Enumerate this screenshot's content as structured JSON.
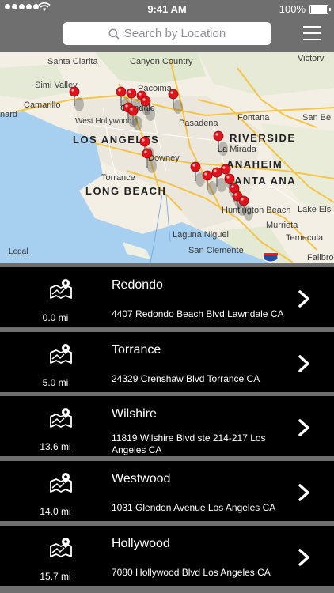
{
  "status_bar": {
    "time": "9:41 AM",
    "battery": "100%"
  },
  "header": {
    "search_placeholder": "Search by Location",
    "menu_icon": "hamburger-menu-icon"
  },
  "map": {
    "labels": {
      "santa_clarita": "Santa Clarita",
      "canyon_country": "Canyon Country",
      "victorville": "Victorv",
      "simi_valley": "Simi Valley",
      "pacoima": "Pacoima",
      "camarillo": "Camarillo",
      "glendale": "Glendale",
      "west_hollywood": "West Hollywood",
      "oxnard": "nard",
      "pasadena": "Pasadena",
      "fontana": "Fontana",
      "san_bernardino": "San Be",
      "los_angeles": "LOS ANGELES",
      "riverside": "RIVERSIDE",
      "downey": "Downey",
      "la_mirada": "La Mirada",
      "anaheim": "ANAHEIM",
      "torrance": "Torrance",
      "santa_ana": "SANTA ANA",
      "long_beach": "LONG BEACH",
      "huntington_beach": "Huntington Beach",
      "lake_elsinore": "Lake Els",
      "murrieta": "Murrieta",
      "temecula": "Temecula",
      "laguna_niguel": "Laguna Niguel",
      "san_clemente": "San Clemente",
      "fallbrook": "Fallbro",
      "legal": "Legal"
    }
  },
  "locations": [
    {
      "name": "Redondo",
      "address": "4407 Redondo Beach Blvd Lawndale CA",
      "distance": "0.0 mi"
    },
    {
      "name": "Torrance",
      "address": "24329 Crenshaw Blvd Torrance CA",
      "distance": "5.0 mi"
    },
    {
      "name": "Wilshire",
      "address": "11819 Wilshire Blvd ste 214-217 Los Angeles CA",
      "distance": "13.6 mi"
    },
    {
      "name": "Westwood",
      "address": "1031 Glendon Avenue  Los Angeles CA",
      "distance": "14.0 mi"
    },
    {
      "name": "Hollywood",
      "address": "7080 Hollywood Blvd Los Angeles CA",
      "distance": "15.7 mi"
    }
  ],
  "colors": {
    "bar_background": "#6f6f6f",
    "row_background": "#000000",
    "pin_red": "#e0141c",
    "water": "#a6cff0"
  }
}
